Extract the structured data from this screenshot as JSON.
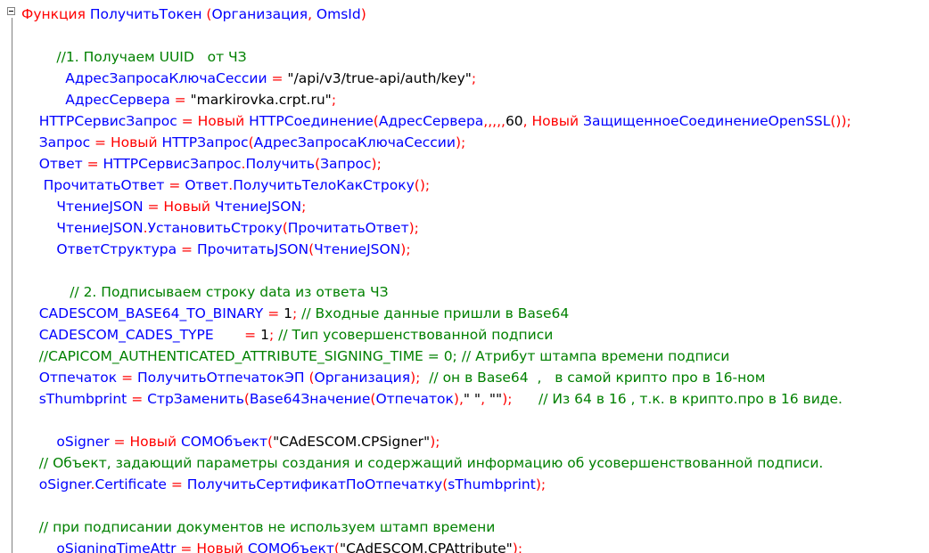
{
  "editor": {
    "lines": [
      [
        {
          "t": "Функция ",
          "c": "kw"
        },
        {
          "t": "ПолучитьТокен",
          "c": "id"
        },
        {
          "t": " (",
          "c": "op"
        },
        {
          "t": "Организация",
          "c": "id"
        },
        {
          "t": ", ",
          "c": "op"
        },
        {
          "t": "OmsId",
          "c": "id"
        },
        {
          "t": ")",
          "c": "op"
        }
      ],
      [],
      [
        {
          "t": "        //1. Получаем UUID   от ЧЗ",
          "c": "cm"
        }
      ],
      [
        {
          "t": "          АдресЗапросаКлючаСессии",
          "c": "id"
        },
        {
          "t": " = ",
          "c": "op"
        },
        {
          "t": "\"/api/v3/true-api/auth/key\"",
          "c": "str"
        },
        {
          "t": ";",
          "c": "op"
        }
      ],
      [
        {
          "t": "          АдресСервера",
          "c": "id"
        },
        {
          "t": " = ",
          "c": "op"
        },
        {
          "t": "\"markirovka.crpt.ru\"",
          "c": "str"
        },
        {
          "t": ";",
          "c": "op"
        }
      ],
      [
        {
          "t": "    HTTPСервисЗапрос",
          "c": "id"
        },
        {
          "t": " = ",
          "c": "op"
        },
        {
          "t": "Новый ",
          "c": "kw"
        },
        {
          "t": "HTTPСоединение",
          "c": "id"
        },
        {
          "t": "(",
          "c": "op"
        },
        {
          "t": "АдресСервера",
          "c": "id"
        },
        {
          "t": ",,,,,",
          "c": "op"
        },
        {
          "t": "60",
          "c": "num"
        },
        {
          "t": ", ",
          "c": "op"
        },
        {
          "t": "Новый ",
          "c": "kw"
        },
        {
          "t": "ЗащищенноеСоединениеOpenSSL",
          "c": "id"
        },
        {
          "t": "());",
          "c": "op"
        }
      ],
      [
        {
          "t": "    Запрос",
          "c": "id"
        },
        {
          "t": " = ",
          "c": "op"
        },
        {
          "t": "Новый ",
          "c": "kw"
        },
        {
          "t": "HTTPЗапрос",
          "c": "id"
        },
        {
          "t": "(",
          "c": "op"
        },
        {
          "t": "АдресЗапросаКлючаСессии",
          "c": "id"
        },
        {
          "t": ");",
          "c": "op"
        }
      ],
      [
        {
          "t": "    Ответ",
          "c": "id"
        },
        {
          "t": " = ",
          "c": "op"
        },
        {
          "t": "HTTPСервисЗапрос",
          "c": "id"
        },
        {
          "t": ".",
          "c": "op"
        },
        {
          "t": "Получить",
          "c": "id"
        },
        {
          "t": "(",
          "c": "op"
        },
        {
          "t": "Запрос",
          "c": "id"
        },
        {
          "t": ");",
          "c": "op"
        }
      ],
      [
        {
          "t": "     ПрочитатьОтвет",
          "c": "id"
        },
        {
          "t": " = ",
          "c": "op"
        },
        {
          "t": "Ответ",
          "c": "id"
        },
        {
          "t": ".",
          "c": "op"
        },
        {
          "t": "ПолучитьТелоКакСтроку",
          "c": "id"
        },
        {
          "t": "();",
          "c": "op"
        }
      ],
      [
        {
          "t": "        ЧтениеJSON",
          "c": "id"
        },
        {
          "t": " = ",
          "c": "op"
        },
        {
          "t": "Новый ",
          "c": "kw"
        },
        {
          "t": "ЧтениеJSON",
          "c": "id"
        },
        {
          "t": ";",
          "c": "op"
        }
      ],
      [
        {
          "t": "        ЧтениеJSON",
          "c": "id"
        },
        {
          "t": ".",
          "c": "op"
        },
        {
          "t": "УстановитьСтроку",
          "c": "id"
        },
        {
          "t": "(",
          "c": "op"
        },
        {
          "t": "ПрочитатьОтвет",
          "c": "id"
        },
        {
          "t": ");",
          "c": "op"
        }
      ],
      [
        {
          "t": "        ОтветСтруктура",
          "c": "id"
        },
        {
          "t": " = ",
          "c": "op"
        },
        {
          "t": "ПрочитатьJSON",
          "c": "id"
        },
        {
          "t": "(",
          "c": "op"
        },
        {
          "t": "ЧтениеJSON",
          "c": "id"
        },
        {
          "t": ");",
          "c": "op"
        }
      ],
      [],
      [
        {
          "t": "           // 2. Подписываем строку data из ответа ЧЗ",
          "c": "cm"
        }
      ],
      [
        {
          "t": "    CADESCOM_BASE64_TO_BINARY",
          "c": "id"
        },
        {
          "t": " = ",
          "c": "op"
        },
        {
          "t": "1",
          "c": "num"
        },
        {
          "t": "; ",
          "c": "op"
        },
        {
          "t": "// Входные данные пришли в Base64",
          "c": "cm"
        }
      ],
      [
        {
          "t": "    CADESCOM_CADES_TYPE       ",
          "c": "id"
        },
        {
          "t": "= ",
          "c": "op"
        },
        {
          "t": "1",
          "c": "num"
        },
        {
          "t": "; ",
          "c": "op"
        },
        {
          "t": "// Тип усовершенствованной подписи",
          "c": "cm"
        }
      ],
      [
        {
          "t": "    //CAPICOM_AUTHENTICATED_ATTRIBUTE_SIGNING_TIME = 0; // Атрибут штампа времени подписи",
          "c": "cm"
        }
      ],
      [
        {
          "t": "    Отпечаток",
          "c": "id"
        },
        {
          "t": " = ",
          "c": "op"
        },
        {
          "t": "ПолучитьОтпечатокЭП",
          "c": "id"
        },
        {
          "t": " (",
          "c": "op"
        },
        {
          "t": "Организация",
          "c": "id"
        },
        {
          "t": ");  ",
          "c": "op"
        },
        {
          "t": "// он в Base64  ,   в самой крипто про в 16-ном",
          "c": "cm"
        }
      ],
      [
        {
          "t": "    sThumbprint",
          "c": "id"
        },
        {
          "t": " = ",
          "c": "op"
        },
        {
          "t": "СтрЗаменить",
          "c": "id"
        },
        {
          "t": "(",
          "c": "op"
        },
        {
          "t": "Base64Значение",
          "c": "id"
        },
        {
          "t": "(",
          "c": "op"
        },
        {
          "t": "Отпечаток",
          "c": "id"
        },
        {
          "t": "),",
          "c": "op"
        },
        {
          "t": "\" \"",
          "c": "str"
        },
        {
          "t": ", ",
          "c": "op"
        },
        {
          "t": "\"\"",
          "c": "str"
        },
        {
          "t": ");      ",
          "c": "op"
        },
        {
          "t": "// Из 64 в 16 , т.к. в крипто.про в 16 виде.",
          "c": "cm"
        }
      ],
      [],
      [
        {
          "t": "        oSigner",
          "c": "id"
        },
        {
          "t": " = ",
          "c": "op"
        },
        {
          "t": "Новый ",
          "c": "kw"
        },
        {
          "t": "COMОбъект",
          "c": "id"
        },
        {
          "t": "(",
          "c": "op"
        },
        {
          "t": "\"CAdESCOM.CPSigner\"",
          "c": "str"
        },
        {
          "t": ");",
          "c": "op"
        }
      ],
      [
        {
          "t": "    // Объект, задающий параметры создания и содержащий информацию об усовершенствованной подписи.",
          "c": "cm"
        }
      ],
      [
        {
          "t": "    oSigner",
          "c": "id"
        },
        {
          "t": ".",
          "c": "op"
        },
        {
          "t": "Certificate",
          "c": "id"
        },
        {
          "t": " = ",
          "c": "op"
        },
        {
          "t": "ПолучитьСертификатПоОтпечатку",
          "c": "id"
        },
        {
          "t": "(",
          "c": "op"
        },
        {
          "t": "sThumbprint",
          "c": "id"
        },
        {
          "t": ");",
          "c": "op"
        }
      ],
      [],
      [
        {
          "t": "    // при подписании документов не используем штамп времени",
          "c": "cm"
        }
      ],
      [
        {
          "t": "        oSigningTimeAttr",
          "c": "id"
        },
        {
          "t": " = ",
          "c": "op"
        },
        {
          "t": "Новый ",
          "c": "kw"
        },
        {
          "t": "COMОбъект",
          "c": "id"
        },
        {
          "t": "(",
          "c": "op"
        },
        {
          "t": "\"CAdESCOM.CPAttribute\"",
          "c": "str"
        },
        {
          "t": ");",
          "c": "op"
        }
      ]
    ]
  },
  "colors": {
    "keyword": "#ff0000",
    "identifier": "#0000ff",
    "operator": "#ff0000",
    "string": "#000000",
    "comment": "#008000"
  }
}
